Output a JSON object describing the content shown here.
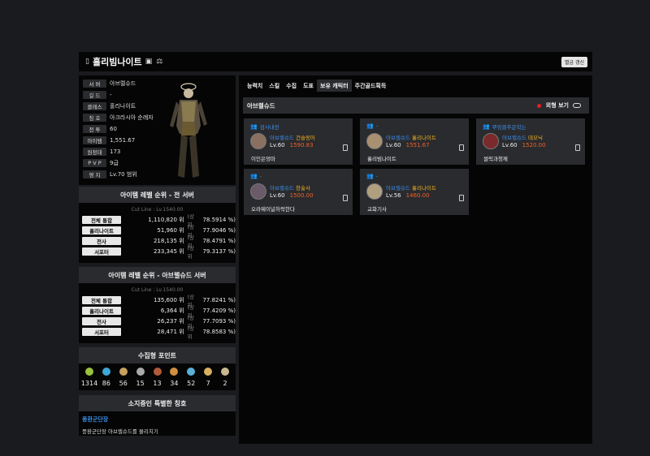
{
  "header": {
    "name": "홀리빔나이트",
    "refresh_label": "별금 갱신"
  },
  "profile": {
    "fields": [
      {
        "label": "서 버",
        "value": "아브렐슈드"
      },
      {
        "label": "길 드",
        "value": "-"
      },
      {
        "label": "클래스",
        "value": "홀리나이트"
      },
      {
        "label": "칭 호",
        "value": "아크라시아 순례자"
      },
      {
        "label": "전 투",
        "value": "60"
      },
      {
        "label": "아이템",
        "value": "1,551.67"
      },
      {
        "label": "원정대",
        "value": "173"
      },
      {
        "label": "P V P",
        "value": "9급"
      },
      {
        "label": "영 지",
        "value": "Lv.70 범위"
      }
    ]
  },
  "rank_all": {
    "title": "아이템 레벨 순위 - 전 서버",
    "cut": "Cut Line : Lv.1540.00",
    "rows": [
      {
        "label": "전체 통합",
        "rank": "1,110,820 위",
        "pre": "(상위",
        "pct": "78.5914 %)"
      },
      {
        "label": "홀리나이트",
        "rank": "51,960 위",
        "pre": "(상위",
        "pct": "77.9046 %)"
      },
      {
        "label": "전사",
        "rank": "218,135 위",
        "pre": "(상위",
        "pct": "78.4791 %)"
      },
      {
        "label": "서포터",
        "rank": "233,345 위",
        "pre": "(상위",
        "pct": "79.3137 %)"
      }
    ]
  },
  "rank_server": {
    "title": "아이템 레벨 순위 - 아브렐슈드 서버",
    "cut": "Cut Line : Lv.1540.00",
    "rows": [
      {
        "label": "전체 통합",
        "rank": "135,600 위",
        "pre": "(상위",
        "pct": "77.8241 %)"
      },
      {
        "label": "홀리나이트",
        "rank": "6,364 위",
        "pre": "(상위",
        "pct": "77.4209 %)"
      },
      {
        "label": "전사",
        "rank": "26,237 위",
        "pre": "(상위",
        "pct": "77.7093 %)"
      },
      {
        "label": "서포터",
        "rank": "28,471 위",
        "pre": "(상위",
        "pct": "78.8583 %)"
      }
    ]
  },
  "collect": {
    "title": "수집형 포인트",
    "items": [
      {
        "icon": "mokoko-seed-icon",
        "value": "1314",
        "color": "#9bc23a"
      },
      {
        "icon": "island-heart-icon",
        "value": "86",
        "color": "#3fa7d8"
      },
      {
        "icon": "great-art-icon",
        "value": "56",
        "color": "#c8a060"
      },
      {
        "icon": "giant-heart-icon",
        "value": "15",
        "color": "#aaaaaa"
      },
      {
        "icon": "ignea-token-icon",
        "value": "13",
        "color": "#b05a3a"
      },
      {
        "icon": "voyage-icon",
        "value": "34",
        "color": "#d09040"
      },
      {
        "icon": "world-tree-leaf-icon",
        "value": "52",
        "color": "#5ab0d8"
      },
      {
        "icon": "orpheus-star-icon",
        "value": "7",
        "color": "#d8b060"
      },
      {
        "icon": "omnium-star-icon",
        "value": "2",
        "color": "#c8b890"
      }
    ]
  },
  "titles": {
    "title": "소지중인 특별한 칭호",
    "name": "풍환군단장",
    "desc": "풍환군단장 아브렐슈드를 물리치기"
  },
  "tabs": [
    "능력치",
    "스킬",
    "수집",
    "도표",
    "보유 캐릭터",
    "주간골드획득"
  ],
  "server_name": "아브렐슈드",
  "outfit_label": "외형 보기",
  "characters": [
    {
      "guild": "검사내전",
      "server": "아브렐슈드",
      "cls": "건슬링어",
      "lv": "Lv.60",
      "il": "1590.83",
      "name": "이인은엉마",
      "avatar": "#8a7060"
    },
    {
      "guild": "-",
      "server": "아브렐슈드",
      "cls": "홀리나이트",
      "lv": "Lv.60",
      "il": "1551.67",
      "name": "홀리빔나이트",
      "avatar": "#a89070"
    },
    {
      "guild": "뿌잉클추문학는",
      "server": "아브렐슈드",
      "cls": "데모닉",
      "lv": "Lv.60",
      "il": "1520.00",
      "name": "썰릭과청께",
      "avatar": "#7a2a2a"
    },
    {
      "guild": "-",
      "server": "아브렐슈드",
      "cls": "창술사",
      "lv": "Lv.60",
      "il": "1500.00",
      "name": "오라웨이널허락한다",
      "avatar": "#6a5a6a"
    },
    {
      "guild": "-",
      "server": "아브렐슈드",
      "cls": "홀리나이트",
      "lv": "Lv.56",
      "il": "1460.00",
      "name": "교화기사",
      "avatar": "#b0a080"
    }
  ]
}
